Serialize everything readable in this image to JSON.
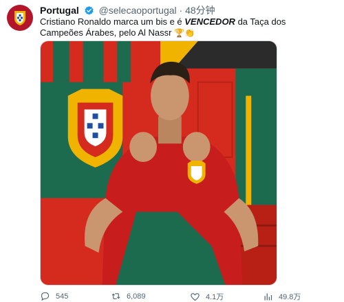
{
  "tweet": {
    "author_name": "Portugal",
    "handle": "@selecaoportugal",
    "separator": "·",
    "time": "48分钟",
    "text_part1": "Cristiano Ronaldo marca um bis e é ",
    "text_emphasis": "VENCEDOR",
    "text_part2": " da Taça dos Campeões Árabes, pelo Al Nassr ",
    "text_emojis": "🏆👏"
  },
  "media": {
    "description_icon": "photo-player-portugal-jersey",
    "colors": {
      "red": "#d52b1e",
      "green": "#1d6b4f",
      "gold": "#f0b400",
      "dark": "#2b2b2b"
    }
  },
  "actions": {
    "replies": "545",
    "retweets": "6,089",
    "likes": "4.1万",
    "views": "49.8万"
  },
  "colors": {
    "verified": "#1d9bf0",
    "muted": "#536471"
  }
}
